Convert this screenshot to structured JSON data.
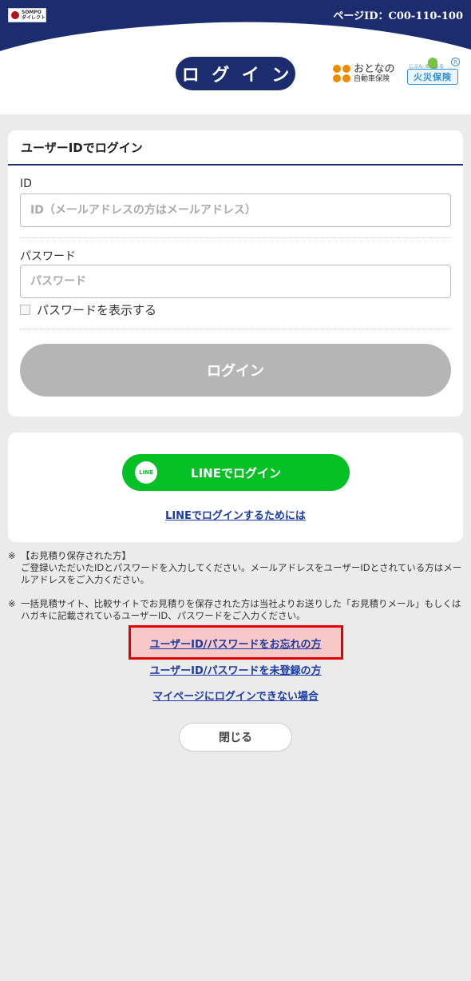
{
  "header": {
    "brand_line1": "SOMPO",
    "brand_line2": "ダイレクト",
    "page_id": "ページID：C00-110-100",
    "title_chars": [
      "ロ",
      "グ",
      "イ",
      "ン"
    ],
    "otona_main": "おとなの",
    "otona_sub": "自動車保険",
    "kasai_sub": "じぶん えらべる",
    "kasai_main": "火災保険",
    "kasai_badge": "R"
  },
  "login_card": {
    "heading": "ユーザーIDでログイン",
    "id_label": "ID",
    "id_placeholder": "ID（メールアドレスの方はメールアドレス）",
    "password_label": "パスワード",
    "password_placeholder": "パスワード",
    "show_password_label": "パスワードを表示する",
    "login_button": "ログイン"
  },
  "line_card": {
    "icon_text": "LINE",
    "button_label": "LINEでログイン",
    "help_link": "LINEでログインするためには"
  },
  "notes": [
    {
      "mark": "※",
      "text": "【お見積り保存された方】\nご登録いただいたIDとパスワードを入力してください。メールアドレスをユーザーIDとされている方はメールアドレスをご入力ください。"
    },
    {
      "mark": "※",
      "text": "一括見積サイト、比較サイトでお見積りを保存された方は当社よりお送りした「お見積りメール」もしくはハガキに記載されているユーザーID、パスワードをご入力ください。"
    }
  ],
  "links": {
    "forgot": "ユーザーID/パスワードをお忘れの方",
    "unregistered": "ユーザーID/パスワードを未登録の方",
    "cannot_login": "マイページにログインできない場合"
  },
  "close_button": "閉じる",
  "colors": {
    "navy": "#1b2d6e",
    "line_green": "#06c125",
    "link_blue": "#1a3aa8",
    "highlight_red": "#e00000"
  }
}
